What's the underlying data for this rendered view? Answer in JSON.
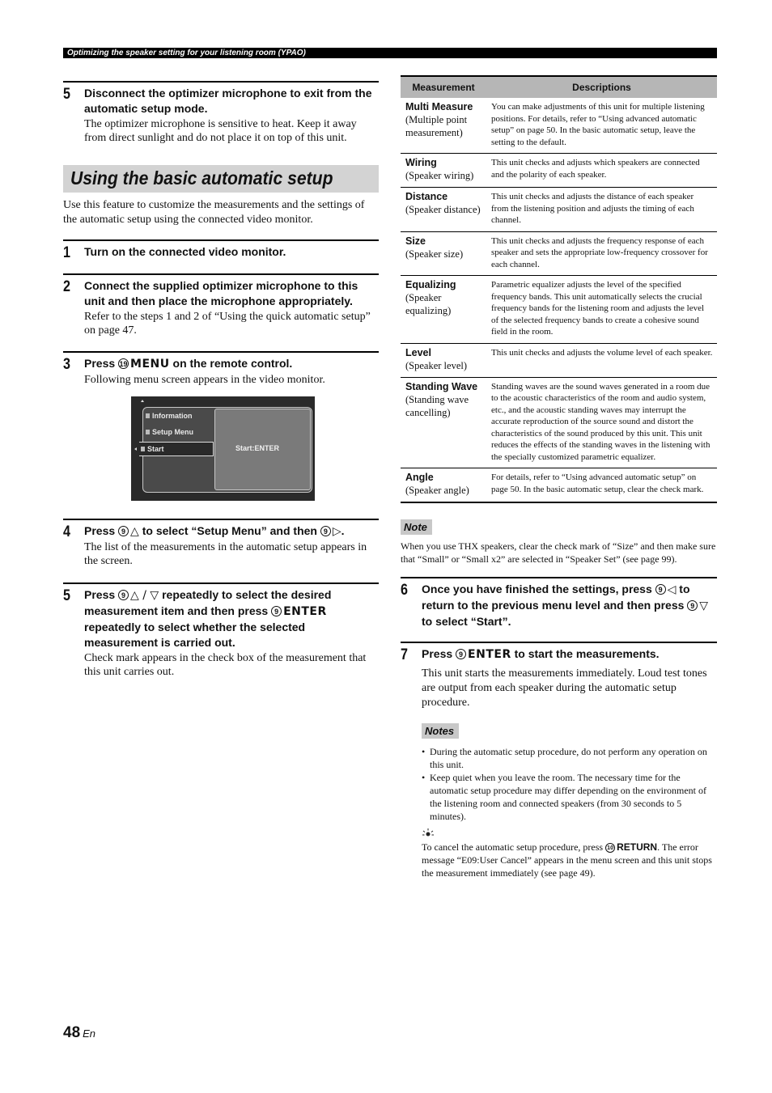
{
  "header": {
    "running_title": "Optimizing the speaker setting for your listening room (YPAO)"
  },
  "left": {
    "step5a": {
      "number": "5",
      "title": "Disconnect the optimizer microphone to exit from the automatic setup mode.",
      "body": "The optimizer microphone is sensitive to heat. Keep it away from direct sunlight and do not place it on top of this unit."
    },
    "section_title": "Using the basic automatic setup",
    "intro": "Use this feature to customize the measurements and the settings of the automatic setup using the connected video monitor.",
    "step1": {
      "number": "1",
      "title": "Turn on the connected video monitor."
    },
    "step2": {
      "number": "2",
      "title": "Connect the supplied optimizer microphone to this unit and then place the microphone appropriately.",
      "body": "Refer to the steps 1 and 2 of “Using the quick automatic setup” on page 47."
    },
    "step3": {
      "number": "3",
      "title_pre": "Press ",
      "key_num": "19",
      "key_name": "MENU",
      "title_post": " on the remote control.",
      "body": "Following menu screen appears in the video monitor."
    },
    "osd": {
      "items": [
        "Information",
        "Setup Menu",
        "Start"
      ],
      "selected": "Start",
      "panel_text": "Start:ENTER"
    },
    "step4": {
      "number": "4",
      "t1": "Press ",
      "key_num": "9",
      "arrow1": "△",
      "t2": " to select “Setup Menu” and then ",
      "arrow2": "▷",
      "t3": ".",
      "body": "The list of the measurements in the automatic setup appears in the screen."
    },
    "step5b": {
      "number": "5",
      "t1": "Press ",
      "key_num": "9",
      "arrows": "△ / ▽",
      "t2": " repeatedly to select the desired measurement item and then press ",
      "key_name": "ENTER",
      "t3": " repeatedly to select whether the selected measurement is carried out.",
      "body": "Check mark appears in the check box of the measurement that this unit carries out."
    }
  },
  "table": {
    "headers": [
      "Measurement",
      "Descriptions"
    ],
    "rows": [
      {
        "name": "Multi Measure",
        "sub": "(Multiple point measurement)",
        "desc": "You can make adjustments of this unit for multiple listening positions. For details, refer to “Using advanced automatic setup” on page 50. In the basic automatic setup, leave the setting to the default."
      },
      {
        "name": "Wiring",
        "sub": "(Speaker wiring)",
        "desc": "This unit checks and adjusts which speakers are connected and the polarity of each speaker."
      },
      {
        "name": "Distance",
        "sub": "(Speaker distance)",
        "desc": "This unit checks and adjusts the distance of each speaker from the listening position and adjusts the timing of each channel."
      },
      {
        "name": "Size",
        "sub": "(Speaker size)",
        "desc": "This unit checks and adjusts the frequency response of each speaker and sets the appropriate low-frequency crossover for each channel."
      },
      {
        "name": "Equalizing",
        "sub": "(Speaker equalizing)",
        "desc": "Parametric equalizer adjusts the level of the specified frequency bands. This unit automatically selects the crucial frequency bands for the listening room and adjusts the level of the selected frequency bands to create a cohesive sound field in the room."
      },
      {
        "name": "Level",
        "sub": "(Speaker level)",
        "desc": "This unit checks and adjusts the volume level of each speaker."
      },
      {
        "name": "Standing Wave",
        "sub": "(Standing wave cancelling)",
        "desc": "Standing waves are the sound waves generated in a room due to the acoustic characteristics of the room and audio system, etc., and the acoustic standing waves may interrupt the accurate reproduction of the source sound and distort the characteristics of the sound produced by this unit. This unit reduces the effects of the standing waves in the listening with the specially customized parametric equalizer."
      },
      {
        "name": "Angle",
        "sub": "(Speaker angle)",
        "desc": "For details, refer to “Using advanced automatic setup” on page 50. In the basic automatic setup, clear the check mark."
      }
    ]
  },
  "right": {
    "note_label": "Note",
    "note_text": "When you use THX speakers, clear the check mark of “Size” and then make sure that “Small” or “Small x2” are selected in “Speaker Set” (see page 99).",
    "step6": {
      "number": "6",
      "t1": "Once you have finished the settings, press ",
      "key_num": "9",
      "arrow1": "◁",
      "t2": " to return to the previous menu level and then press ",
      "arrow2": "▽",
      "t3": " to select “Start”."
    },
    "step7": {
      "number": "7",
      "t1": "Press ",
      "key_num": "9",
      "key_name": "ENTER",
      "t2": " to start the measurements.",
      "body": "This unit starts the measurements immediately. Loud test tones are output from each speaker during the automatic setup procedure."
    },
    "notes_label": "Notes",
    "notes": [
      "During the automatic setup procedure, do not perform any operation on this unit.",
      "Keep quiet when you leave the room. The necessary time for the automatic setup procedure may differ depending on the environment of the listening room and connected speakers (from 30 seconds to 5 minutes)."
    ],
    "tip": {
      "icon": "lightbulb-icon",
      "t1": "To cancel the automatic setup procedure, press ",
      "key_num": "10",
      "key_name": "RETURN",
      "t2": ". The error message “E09:User Cancel” appears in the menu screen and this unit stops the measurement immediately (see page 49)."
    }
  },
  "footer": {
    "page_number": "48",
    "language": "En"
  }
}
